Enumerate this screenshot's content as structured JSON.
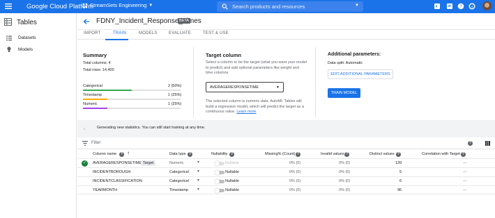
{
  "topbar": {
    "brand": "Google Cloud Platform",
    "project": "StreamSets Engineering",
    "search_placeholder": "Search products and resources",
    "bg": "#1a73e8"
  },
  "sidebar": {
    "title": "Tables",
    "items": [
      {
        "label": "Datasets",
        "icon": "dataset-icon"
      },
      {
        "label": "Models",
        "icon": "lightbulb-icon"
      }
    ]
  },
  "header": {
    "title": "FDNY_Incident_Response_Times",
    "badge": "BETA"
  },
  "tabs": [
    {
      "label": "IMPORT"
    },
    {
      "label": "TRAIN"
    },
    {
      "label": "MODELS"
    },
    {
      "label": "EVALUATE"
    },
    {
      "label": "TEST & USE"
    }
  ],
  "active_tab": "TRAIN",
  "summary": {
    "heading": "Summary",
    "total_columns": "Total columns: 4",
    "total_rows": "Total rows: 14,400",
    "types": [
      {
        "name": "Categorical",
        "value": "2 (50%)",
        "fraction": 0.5,
        "color": "#34a853"
      },
      {
        "name": "Timestamp",
        "value": "1 (25%)",
        "fraction": 0.25,
        "color": "#f9ab00"
      },
      {
        "name": "Numeric",
        "value": "1 (25%)",
        "fraction": 0.25,
        "color": "#a142f4"
      }
    ]
  },
  "target": {
    "heading": "Target column",
    "desc": "Select a column to be the target (what you want your model to predict) and add optional parameters like weight and time columns",
    "selected": "AVERAGERESPONSETIME",
    "note": "The selected column is numeric data. AutoML Tables will build a regression model, which will predict the target as a continuous value.",
    "learn_more": "Learn more"
  },
  "additional": {
    "heading": "Additional parameters:",
    "data_split": "Data split: Automatic",
    "edit_button": "EDIT ADDITIONAL PARAMETERS",
    "train_button": "TRAIN MODEL"
  },
  "status_text": "Generating new statistics. You can still start training at any time.",
  "filter_label": "Filter",
  "table": {
    "headers": {
      "column_name": "Column name",
      "data_type": "Data type",
      "nullability": "Nullability",
      "missing": "Missing% (Count)",
      "invalid": "Invalid values",
      "distinct": "Distinct values",
      "correlation": "Correlation with Target"
    },
    "rows": [
      {
        "name": "AVERAGERESPONSETIME",
        "target": "Target",
        "type": "Numeric",
        "nullable": "Nullable",
        "missing": "0% (0)",
        "invalid": "0% (0)",
        "distinct": "139",
        "corr": "---"
      },
      {
        "name": "INCIDENTBOROUGH",
        "target": "",
        "type": "Categorical",
        "nullable": "Nullable",
        "missing": "0% (0)",
        "invalid": "0% (0)",
        "distinct": "5",
        "corr": "---"
      },
      {
        "name": "INCIDENTCLASSIFICATION",
        "target": "",
        "type": "Categorical",
        "nullable": "Nullable",
        "missing": "0% (0)",
        "invalid": "0% (0)",
        "distinct": "6",
        "corr": "---"
      },
      {
        "name": "YEARMONTH",
        "target": "",
        "type": "Timestamp",
        "nullable": "Nullable",
        "missing": "0% (0)",
        "invalid": "0% (0)",
        "distinct": "96",
        "corr": "---"
      }
    ]
  }
}
